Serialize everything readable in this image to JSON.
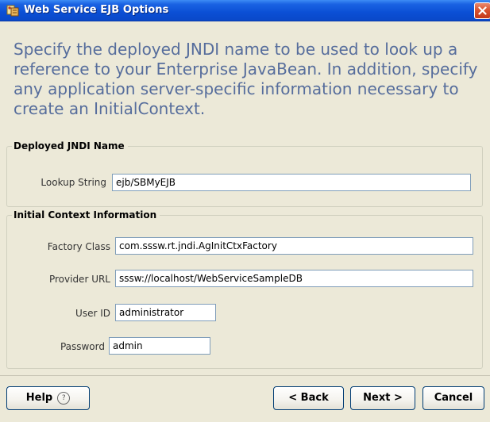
{
  "window": {
    "title": "Web Service EJB Options"
  },
  "intro_text": "Specify the deployed JNDI name to be used to look up a reference to your Enterprise JavaBean. In addition, specify any application server-specific information necessary to create an InitialContext.",
  "jndi_group": {
    "legend": "Deployed JNDI Name",
    "lookup_label": "Lookup String",
    "lookup_value": "ejb/SBMyEJB"
  },
  "context_group": {
    "legend": "Initial Context Information",
    "factory_label": "Factory Class",
    "factory_value": "com.sssw.rt.jndi.AgInitCtxFactory",
    "provider_label": "Provider URL",
    "provider_value": "sssw://localhost/WebServiceSampleDB",
    "userid_label": "User ID",
    "userid_value": "administrator",
    "password_label": "Password",
    "password_value": "admin"
  },
  "buttons": {
    "help": "Help",
    "help_glyph": "?",
    "back": "< Back",
    "next": "Next >",
    "cancel": "Cancel"
  },
  "colors": {
    "titlebar": "#0a48c8",
    "intro_text": "#566d9c",
    "dialog_bg": "#ece9d8"
  },
  "icons": {
    "app": "wizard-icon",
    "close": "close-icon",
    "help": "help-icon"
  }
}
